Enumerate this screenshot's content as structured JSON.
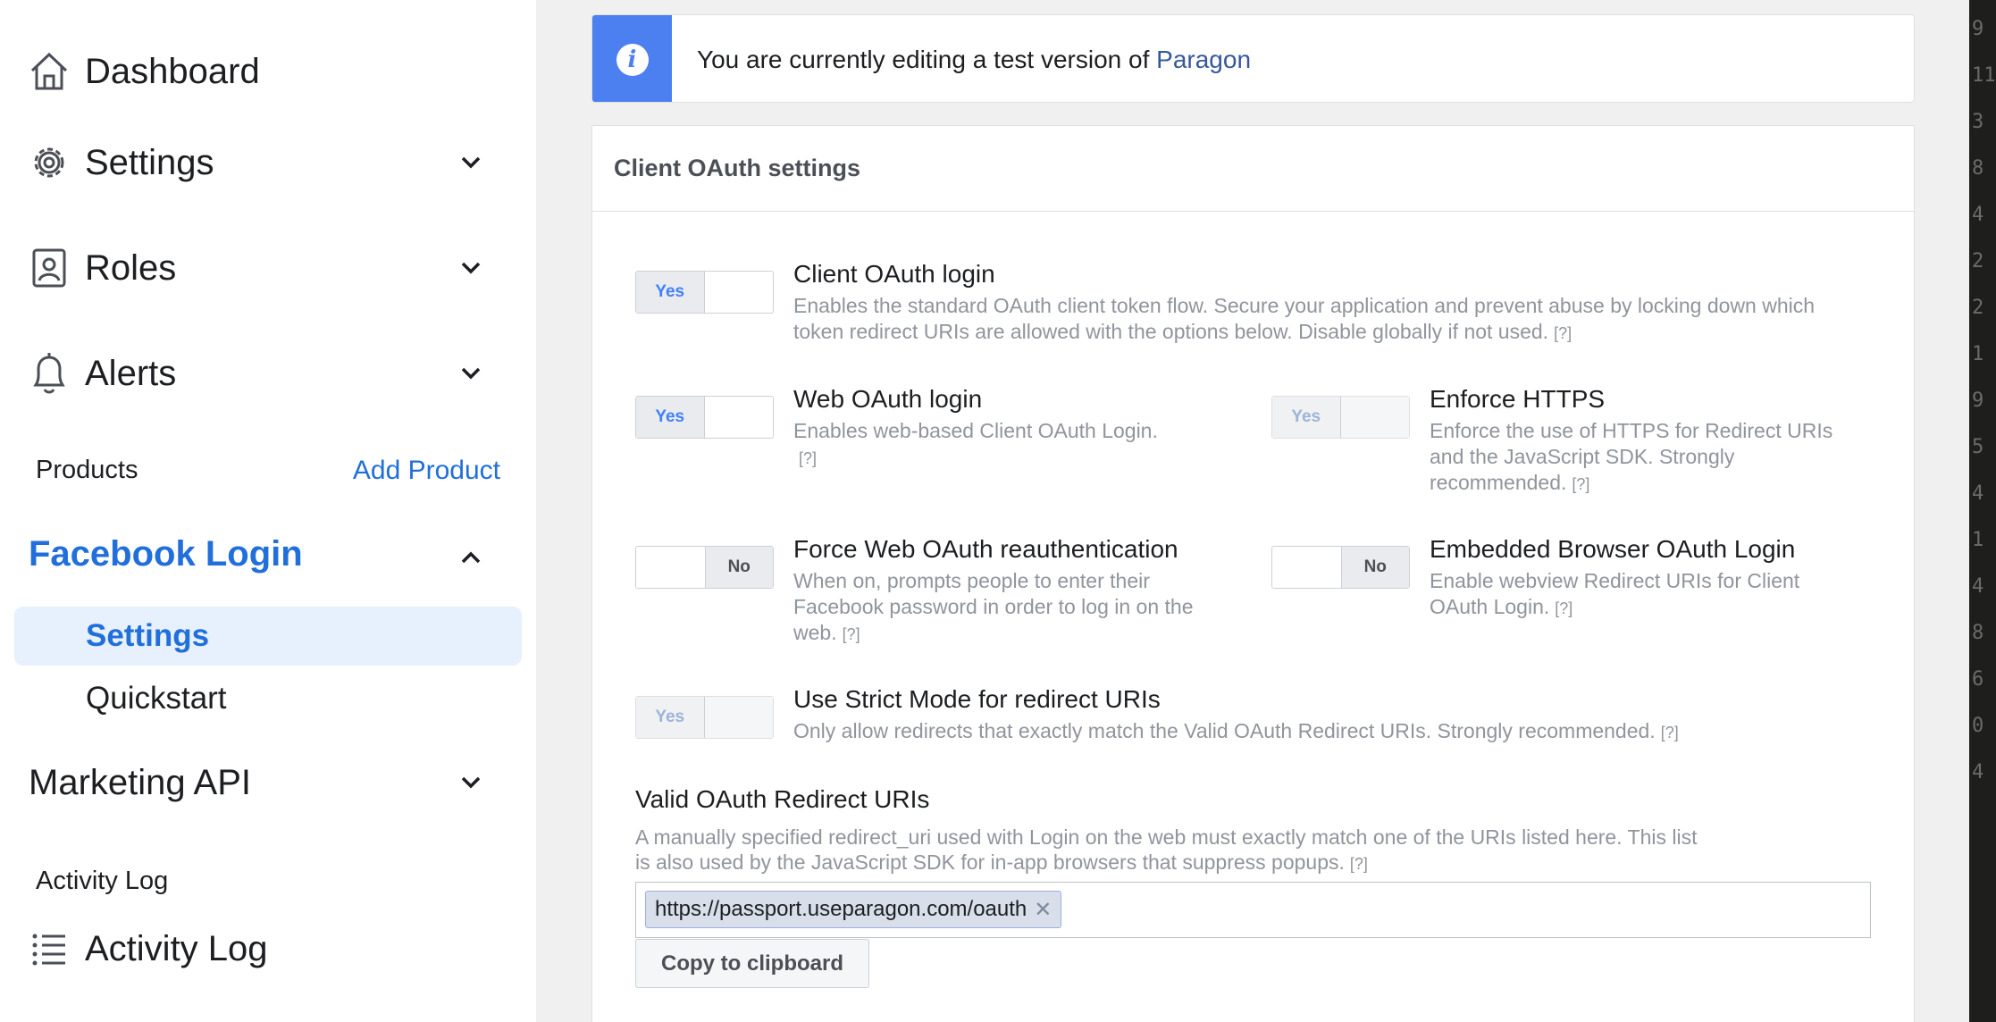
{
  "sidebar": {
    "dashboard": "Dashboard",
    "settings": "Settings",
    "roles": "Roles",
    "alerts": "Alerts",
    "products_label": "Products",
    "add_product": "Add Product",
    "facebook_login": "Facebook Login",
    "fb_settings": "Settings",
    "fb_quickstart": "Quickstart",
    "marketing_api": "Marketing API",
    "activity_log_section": "Activity Log",
    "activity_log": "Activity Log"
  },
  "notice": {
    "text": "You are currently editing a test version of ",
    "link": "Paragon"
  },
  "panel": {
    "title": "Client OAuth settings",
    "help": "[?]",
    "settings": [
      {
        "title": "Client OAuth login",
        "desc": "Enables the standard OAuth client token flow. Secure your application and prevent abuse by locking down which token redirect URIs are allowed with the options below. Disable globally if not used.",
        "toggle": "Yes"
      },
      {
        "title": "Web OAuth login",
        "desc": "Enables web-based Client OAuth Login.",
        "toggle": "Yes"
      },
      {
        "title": "Enforce HTTPS",
        "desc": "Enforce the use of HTTPS for Redirect URIs and the JavaScript SDK. Strongly recommended.",
        "toggle": "Yes"
      },
      {
        "title": "Force Web OAuth reauthentication",
        "desc": "When on, prompts people to enter their Facebook password in order to log in on the web.",
        "toggle": "No"
      },
      {
        "title": "Embedded Browser OAuth Login",
        "desc": "Enable webview Redirect URIs for Client OAuth Login.",
        "toggle": "No"
      },
      {
        "title": "Use Strict Mode for redirect URIs",
        "desc": "Only allow redirects that exactly match the Valid OAuth Redirect URIs. Strongly recommended.",
        "toggle": "Yes"
      }
    ],
    "uri_title": "Valid OAuth Redirect URIs",
    "uri_desc": "A manually specified redirect_uri used with Login on the web must exactly match one of the URIs listed here. This list is also used by the JavaScript SDK for in-app browsers that suppress popups.",
    "uri_value": "https://passport.useparagon.com/oauth",
    "copy_button": "Copy to clipboard"
  },
  "gutter": [
    "9",
    "11",
    "3",
    "8",
    "4",
    "2",
    "2",
    "1",
    "9",
    "5",
    "4",
    "1",
    "4",
    "8",
    "6",
    "0",
    "4"
  ],
  "colors": {
    "accent": "#216fdb",
    "info": "#4c7ff0"
  }
}
